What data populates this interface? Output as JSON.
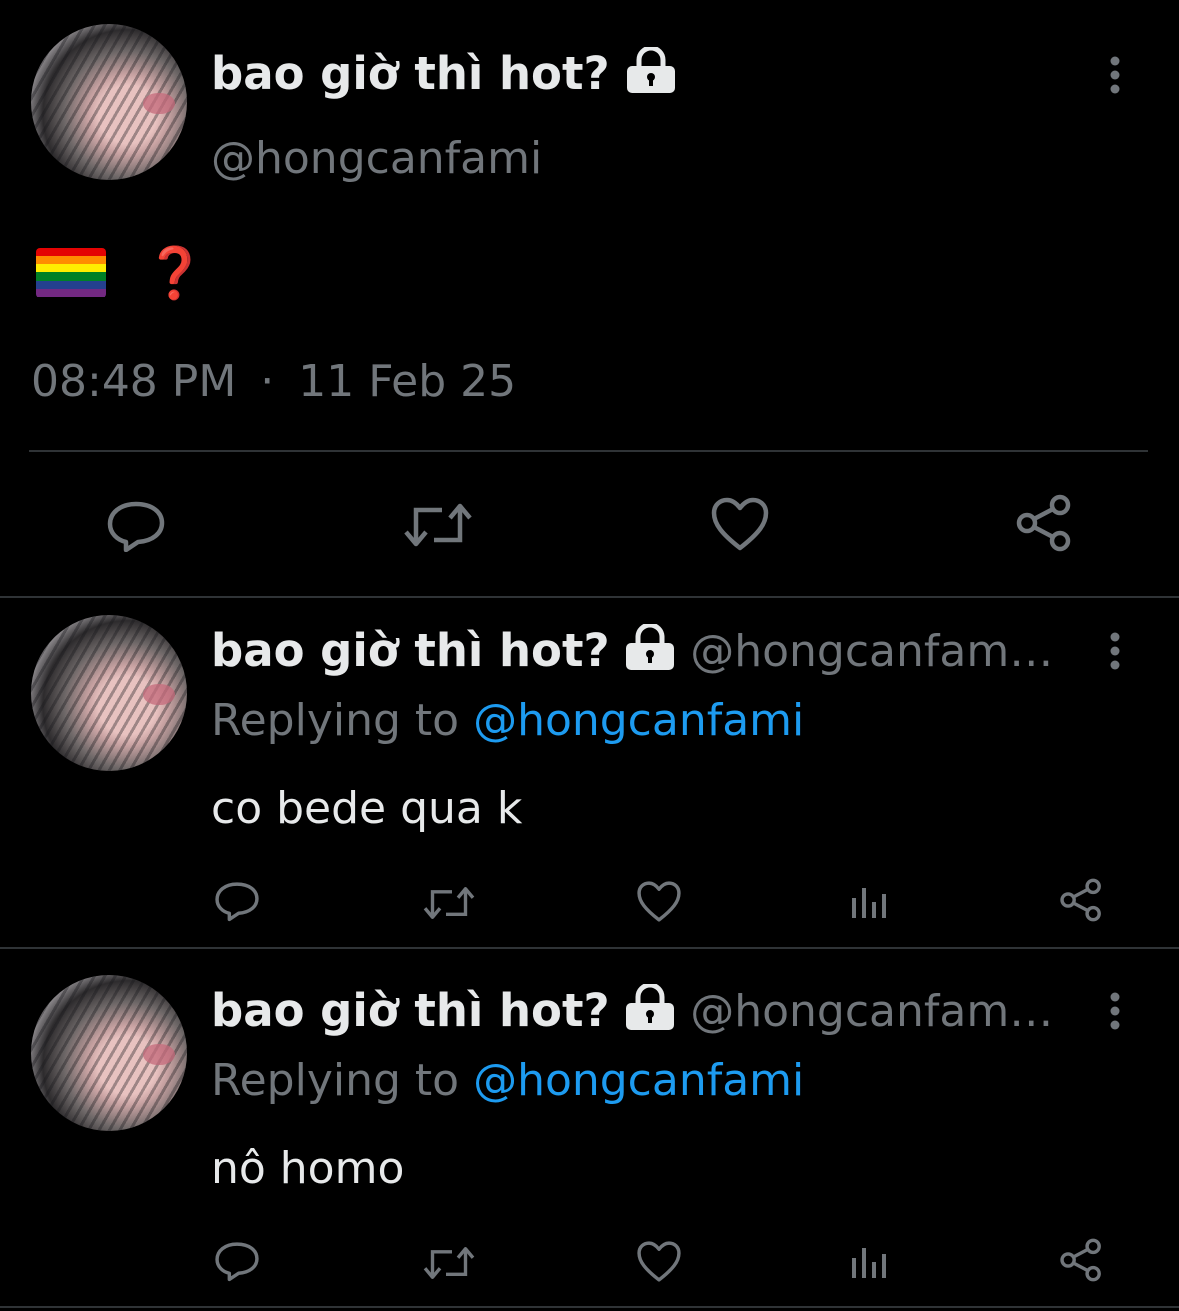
{
  "main_tweet": {
    "display_name": "bao giờ thì hot?",
    "handle": "@hongcanfami",
    "body_emoji": "🏳️‍🌈",
    "body_text": "❓",
    "time": "08:48 PM",
    "separator": "·",
    "date": "11 Feb 25"
  },
  "replies": [
    {
      "display_name": "bao giờ thì hot?",
      "handle": "@hongcanfam…",
      "replying_prefix": "Replying to",
      "replying_to": "@hongcanfami",
      "text": "co bede qua k"
    },
    {
      "display_name": "bao giờ thì hot?",
      "handle": "@hongcanfam…",
      "replying_prefix": "Replying to",
      "replying_to": "@hongcanfami",
      "text": "nô homo"
    }
  ],
  "colors": {
    "background": "#000000",
    "text": "#e7e9ea",
    "muted": "#71767b",
    "link": "#1d9bf0",
    "divider": "#2f3336"
  },
  "icons": [
    "lock-icon",
    "more-vertical-icon",
    "reply-icon",
    "retweet-icon",
    "like-icon",
    "views-icon",
    "share-icon"
  ]
}
